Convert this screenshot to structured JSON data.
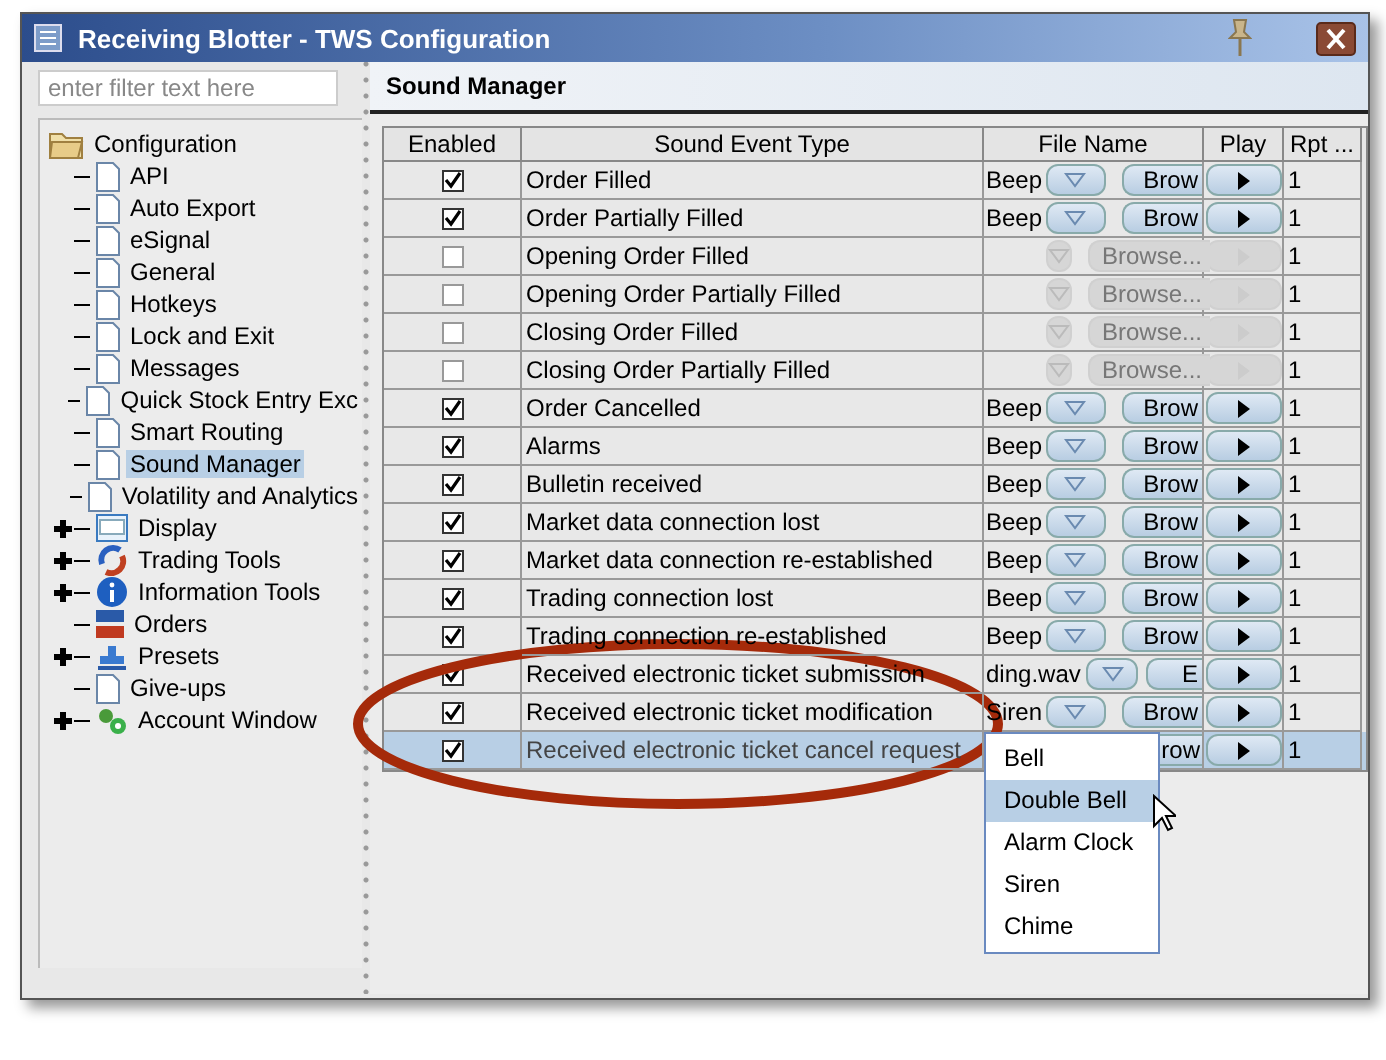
{
  "window": {
    "title": "Receiving Blotter - TWS Configuration"
  },
  "sidebar": {
    "filter": {
      "placeholder": "enter filter text here"
    },
    "tree": [
      {
        "label": "Configuration",
        "kind": "folder",
        "selected": false,
        "children": [
          {
            "label": "API",
            "kind": "page",
            "selected": false
          },
          {
            "label": "Auto Export",
            "kind": "page",
            "selected": false
          },
          {
            "label": "eSignal",
            "kind": "page",
            "selected": false
          },
          {
            "label": "General",
            "kind": "page",
            "selected": false
          },
          {
            "label": "Hotkeys",
            "kind": "page",
            "selected": false
          },
          {
            "label": "Lock and Exit",
            "kind": "page",
            "selected": false
          },
          {
            "label": "Messages",
            "kind": "page",
            "selected": false
          },
          {
            "label": "Quick Stock Entry Exc",
            "kind": "page",
            "selected": false
          },
          {
            "label": "Smart Routing",
            "kind": "page",
            "selected": false
          },
          {
            "label": "Sound Manager",
            "kind": "page",
            "selected": true
          },
          {
            "label": "Volatility and Analytics",
            "kind": "page",
            "selected": false
          },
          {
            "label": "Display",
            "kind": "display",
            "selected": false,
            "expanded": false
          },
          {
            "label": "Trading Tools",
            "kind": "trading",
            "selected": false,
            "expanded": false
          },
          {
            "label": "Information Tools",
            "kind": "info",
            "selected": false,
            "expanded": false
          },
          {
            "label": "Orders",
            "kind": "orders",
            "selected": false
          },
          {
            "label": "Presets",
            "kind": "presets",
            "selected": false,
            "expanded": false
          },
          {
            "label": "Give-ups",
            "kind": "page",
            "selected": false
          },
          {
            "label": "Account Window",
            "kind": "account",
            "selected": false,
            "expanded": false
          }
        ]
      }
    ]
  },
  "panel": {
    "title": "Sound Manager"
  },
  "table": {
    "columns": [
      "Enabled",
      "Sound Event Type",
      "File Name",
      "Play",
      "Rpt ..."
    ],
    "rows": [
      {
        "checked": true,
        "event": "Order Filled",
        "file": "Beep",
        "browse": "Brow",
        "rpt": "1",
        "selected": false
      },
      {
        "checked": true,
        "event": "Order Partially Filled",
        "file": "Beep",
        "browse": "Brow",
        "rpt": "1",
        "selected": false
      },
      {
        "checked": false,
        "event": "Opening Order Filled",
        "browse": "Browse...",
        "rpt": "1",
        "selected": false
      },
      {
        "checked": false,
        "event": "Opening Order Partially Filled",
        "browse": "Browse...",
        "rpt": "1",
        "selected": false
      },
      {
        "checked": false,
        "event": "Closing Order Filled",
        "browse": "Browse...",
        "rpt": "1",
        "selected": false
      },
      {
        "checked": false,
        "event": "Closing Order Partially Filled",
        "browse": "Browse...",
        "rpt": "1",
        "selected": false
      },
      {
        "checked": true,
        "event": "Order Cancelled",
        "file": "Beep",
        "browse": "Brow",
        "rpt": "1",
        "selected": false
      },
      {
        "checked": true,
        "event": "Alarms",
        "file": "Beep",
        "browse": "Brow",
        "rpt": "1",
        "selected": false
      },
      {
        "checked": true,
        "event": "Bulletin received",
        "file": "Beep",
        "browse": "Brow",
        "rpt": "1",
        "selected": false
      },
      {
        "checked": true,
        "event": "Market data connection lost",
        "file": "Beep",
        "browse": "Brow",
        "rpt": "1",
        "selected": false
      },
      {
        "checked": true,
        "event": "Market data connection re-established",
        "file": "Beep",
        "browse": "Brow",
        "rpt": "1",
        "selected": false
      },
      {
        "checked": true,
        "event": "Trading connection lost",
        "file": "Beep",
        "browse": "Brow",
        "rpt": "1",
        "selected": false
      },
      {
        "checked": true,
        "event": "Trading connection re-established",
        "file": "Beep",
        "browse": "Brow",
        "rpt": "1",
        "selected": false
      },
      {
        "checked": true,
        "event": "Received electronic ticket submission",
        "file": "ding.wav",
        "browse": "E",
        "rpt": "1",
        "selected": false
      },
      {
        "checked": true,
        "event": "Received electronic ticket modification",
        "file": "Siren",
        "browse": "Brow",
        "rpt": "1",
        "selected": false
      },
      {
        "checked": true,
        "event": "Received electronic ticket cancel request",
        "browse": "row",
        "rpt": "1",
        "selected": true
      }
    ],
    "dropdown": [
      {
        "label": "Bell",
        "selected": false
      },
      {
        "label": "Double Bell",
        "selected": true
      },
      {
        "label": "Alarm Clock",
        "selected": false
      },
      {
        "label": "Siren",
        "selected": false
      },
      {
        "label": "Chime",
        "selected": false
      }
    ]
  }
}
